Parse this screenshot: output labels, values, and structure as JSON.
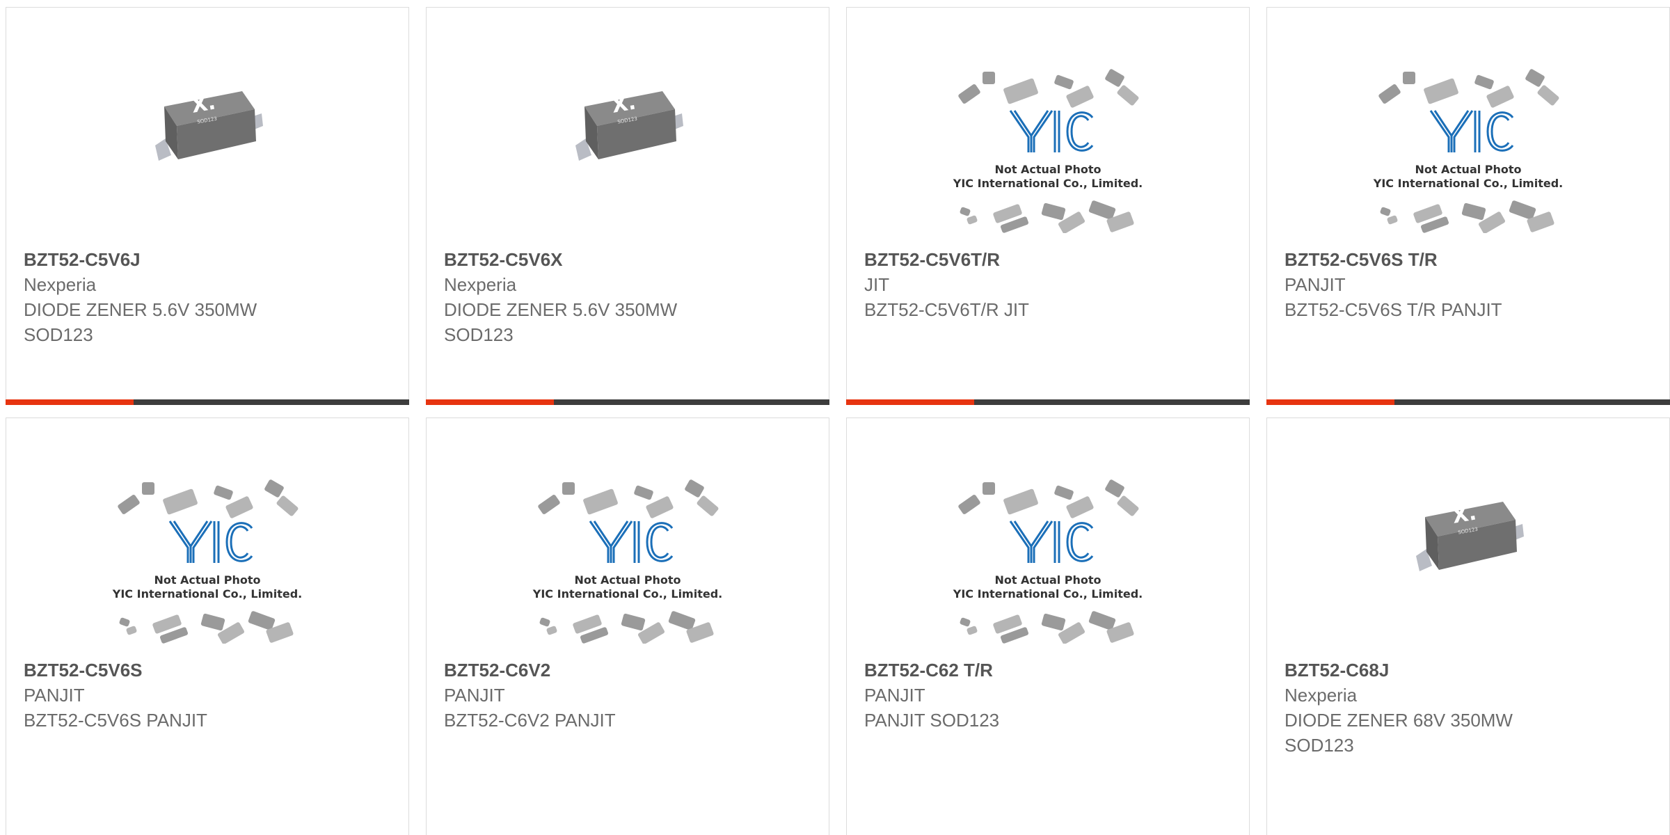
{
  "products": [
    {
      "part": "BZT52-C5V6J",
      "maker": "Nexperia",
      "desc1": "DIODE ZENER 5.6V 350MW",
      "desc2": "SOD123",
      "image": "chip-photo",
      "chip_mark": "X.",
      "chip_sub": "SOD123",
      "show_bar": true
    },
    {
      "part": "BZT52-C5V6X",
      "maker": "Nexperia",
      "desc1": "DIODE ZENER 5.6V 350MW",
      "desc2": "SOD123",
      "image": "chip-photo",
      "chip_mark": "X.",
      "chip_sub": "SOD123",
      "show_bar": true
    },
    {
      "part": "BZT52-C5V6T/R",
      "maker": "JIT",
      "desc1": "BZT52-C5V6T/R JIT",
      "desc2": "",
      "image": "placeholder",
      "show_bar": true
    },
    {
      "part": "BZT52-C5V6S T/R",
      "maker": "PANJIT",
      "desc1": "BZT52-C5V6S T/R PANJIT",
      "desc2": "",
      "image": "placeholder",
      "show_bar": true
    },
    {
      "part": "BZT52-C5V6S",
      "maker": "PANJIT",
      "desc1": "BZT52-C5V6S PANJIT",
      "desc2": "",
      "image": "placeholder",
      "show_bar": false
    },
    {
      "part": "BZT52-C6V2",
      "maker": "PANJIT",
      "desc1": "BZT52-C6V2 PANJIT",
      "desc2": "",
      "image": "placeholder",
      "show_bar": false
    },
    {
      "part": "BZT52-C62 T/R",
      "maker": "PANJIT",
      "desc1": "PANJIT SOD123",
      "desc2": "",
      "image": "placeholder",
      "show_bar": false
    },
    {
      "part": "BZT52-C68J",
      "maker": "Nexperia",
      "desc1": "DIODE ZENER 68V 350MW",
      "desc2": "SOD123",
      "image": "chip-photo",
      "chip_mark": "X.",
      "chip_sub": "SOD123",
      "show_bar": false
    }
  ],
  "placeholder": {
    "logo": "YIC",
    "line1": "Not Actual Photo",
    "line2": "YIC International Co., Limited."
  },
  "colors": {
    "accent": "#e73410",
    "bar": "#3d3d3d",
    "logo_blue": "#1b6fb8"
  }
}
